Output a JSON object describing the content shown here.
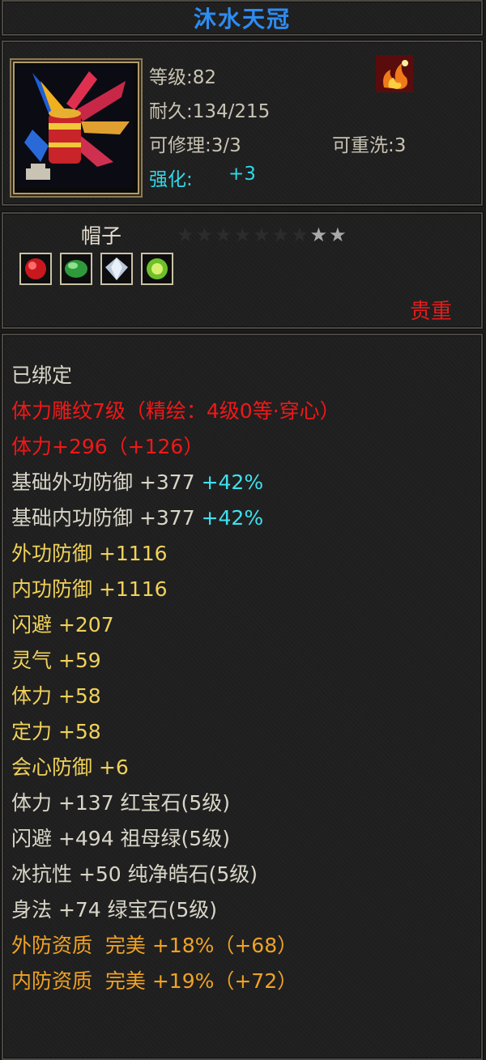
{
  "item": {
    "name": "沐水天冠",
    "level": "等级:82",
    "durability": "耐久:134/215",
    "repairable": "可修理:3/3",
    "rewashable": "可重洗:3",
    "enhance_label": "强化:",
    "enhance_value": "+3",
    "type": "帽子",
    "rarity": "贵重",
    "stars": {
      "total": 9,
      "lit": 2
    }
  },
  "gems": [
    {
      "name": "ruby-gem-icon",
      "color": "#d8202a"
    },
    {
      "name": "emerald-gem-icon",
      "color": "#3fa84a"
    },
    {
      "name": "diamond-gem-icon",
      "color": "#c8d6e6"
    },
    {
      "name": "peridot-gem-icon",
      "color": "#8ad03a"
    }
  ],
  "stats": {
    "bound": "已绑定",
    "engrave": "体力雕纹7级（精绘：4级0等·穿心）",
    "vit_bonus": "体力+296（+126）",
    "base_ext_def": "基础外功防御 +377",
    "base_ext_def_pct": "+42%",
    "base_int_def": "基础内功防御 +377",
    "base_int_def_pct": "+42%",
    "ext_def": "外功防御 +1116",
    "int_def": "内功防御 +1116",
    "dodge": "闪避 +207",
    "spirit": "灵气 +59",
    "vitality": "体力 +58",
    "focus": "定力 +58",
    "crit_def": "会心防御 +6",
    "gem1": "体力 +137 红宝石(5级)",
    "gem2": "闪避 +494 祖母绿(5级)",
    "gem3": "冰抗性 +50 纯净皓石(5级)",
    "gem4": "身法 +74 绿宝石(5级)",
    "quality1": "外防资质  完美 +18%（+68）",
    "quality2": "内防资质  完美 +19%（+72）"
  }
}
